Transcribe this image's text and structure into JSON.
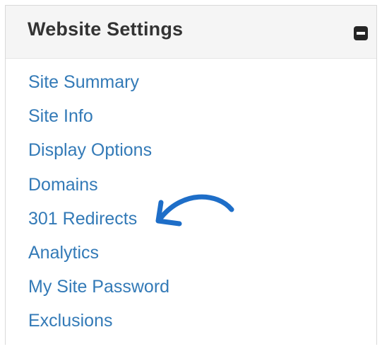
{
  "panel": {
    "title": "Website Settings",
    "collapse_icon": "minus-square-icon"
  },
  "nav": {
    "items": [
      {
        "label": "Site Summary"
      },
      {
        "label": "Site Info"
      },
      {
        "label": "Display Options"
      },
      {
        "label": "Domains"
      },
      {
        "label": "301 Redirects"
      },
      {
        "label": "Analytics"
      },
      {
        "label": "My Site Password"
      },
      {
        "label": "Exclusions"
      }
    ]
  },
  "annotation": {
    "icon": "arrow-pointer-icon",
    "target": "301 Redirects",
    "color": "#1e6ec8"
  },
  "colors": {
    "link": "#337ab7",
    "title": "#333333",
    "header_bg": "#f5f5f5"
  }
}
